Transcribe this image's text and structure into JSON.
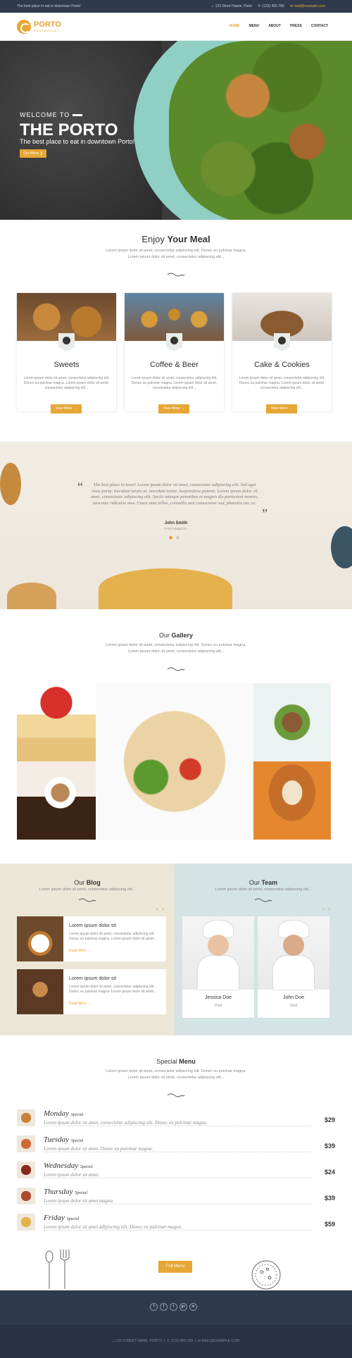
{
  "topbar": {
    "tagline": "The best place to eat in downtown Porto!",
    "address": "123 Street Name, Porto",
    "phone": "(123) 456-789",
    "email": "mail@example.com"
  },
  "header": {
    "logo_title": "PORTO",
    "logo_sub": "RESTAURANT",
    "nav": [
      "HOME",
      "MENU",
      "ABOUT",
      "PRESS",
      "CONTACT"
    ]
  },
  "hero": {
    "welcome": "WELCOME TO",
    "title": "THE PORTO",
    "subtitle": "The best place to eat in downtown Porto!",
    "button": "Our Menu"
  },
  "enjoy": {
    "title_light": "Enjoy",
    "title_bold": "Your Meal",
    "text1": "Lorem ipsum dolor sit amet, consectetur adipiscing elit. Donec eu pulvinar magna.",
    "text2": "Lorem ipsum dolor sit amet, consectetur adipiscing elit..."
  },
  "cards": [
    {
      "name": "Sweets",
      "text": "Lorem ipsum dolor sit amet, consectetur adipiscing elit. Donec eu pulvinar magna. Lorem ipsum dolor sit amet, consectetur adipiscing elit...",
      "button": "View More"
    },
    {
      "name": "Coffee & Beer",
      "text": "Lorem ipsum dolor sit amet, consectetur adipiscing elit. Donec eu pulvinar magna. Lorem ipsum dolor sit amet, consectetur adipiscing elit...",
      "button": "View More"
    },
    {
      "name": "Cake & Cookies",
      "text": "Lorem ipsum dolor sit amet, consectetur adipiscing elit. Donec eu pulvinar magna. Lorem ipsum dolor sit amet, consectetur adipiscing elit...",
      "button": "View More"
    }
  ],
  "testimonial": {
    "quote": "The best place in town! Lorem ipsum dolor sit amet, consectetur adipiscing elit. Sed eget risus porta, tincidunt turpis at, interdum tortor. Suspendisse potenti. Lorem ipsum dolor sit amet, consectetur adipiscing elit. Sociis natoque penatibus et magnis dis parturient montes, nascetur ridiculus mus. Fusce ante tellus, convallis non consectetur sed, pharetra nec ex.",
    "author": "John Smith",
    "source": "Porto Magazine"
  },
  "gallery": {
    "title_light": "Our",
    "title_bold": "Gallery",
    "text1": "Lorem ipsum dolor sit amet, consectetur adipiscing elit. Donec eu pulvinar magna.",
    "text2": "Lorem ipsum dolor sit amet, consectetur adipiscing elit..."
  },
  "blog": {
    "title_light": "Our",
    "title_bold": "Blog",
    "text": "Lorem ipsum dolor sit amet, consectetur adipiscing elit...",
    "posts": [
      {
        "title": "Lorem ipsum dolor sit",
        "excerpt": "Lorem ipsum dolor sit amet, consectetur adipiscing elit. Donec eu pulvinar magna. Lorem ipsum dolor sit amet...",
        "read_more": "Read More"
      },
      {
        "title": "Lorem ipsum dolor sit",
        "excerpt": "Lorem ipsum dolor sit amet, consectetur adipiscing elit. Donec eu pulvinar magna. Lorem ipsum dolor sit amet...",
        "read_more": "Read More"
      }
    ]
  },
  "team": {
    "title_light": "Our",
    "title_bold": "Team",
    "text": "Lorem ipsum dolor sit amet, consectetur adipiscing elit...",
    "members": [
      {
        "name": "Jessica Doe",
        "role": "Chef"
      },
      {
        "name": "John Doe",
        "role": "Chef"
      }
    ]
  },
  "special": {
    "title_light": "Special",
    "title_bold": "Menu",
    "text1": "Lorem ipsum dolor sit amet, consectetur adipiscing elit. Donec eu pulvinar magna.",
    "text2": "Lorem ipsum dolor sit amet, consectetur adipiscing elit...",
    "items": [
      {
        "day": "Monday",
        "tag": "Special",
        "desc": "Lorem ipsum dolor sit amet, consectetur adipiscing elit. Donec eu pulvinar magna.",
        "price": "$29"
      },
      {
        "day": "Tuesday",
        "tag": "Special",
        "desc": "Lorem ipsum dolor sit amet. Donec eu pulvinar magna.",
        "price": "$39"
      },
      {
        "day": "Wednesday",
        "tag": "Special",
        "desc": "Lorem ipsum dolor sit amet.",
        "price": "$24"
      },
      {
        "day": "Thursday",
        "tag": "Special",
        "desc": "Lorem ipsum dolor sit amet magna.",
        "price": "$39"
      },
      {
        "day": "Friday",
        "tag": "Special",
        "desc": "Lorem ipsum dolor sit amet adipiscing elit. Donec eu pulvinar magna.",
        "price": "$59"
      }
    ],
    "button": "Full Menu"
  },
  "footer": {
    "social": [
      "f",
      "t",
      "in",
      "g+",
      "yt"
    ],
    "address": "123 STREET NAME, PORTO",
    "phone": "(123) 456-789",
    "email": "MAIL@EXAMPLE.COM"
  },
  "colors": {
    "accent": "#e7a635",
    "dark": "#2f3a4e"
  }
}
